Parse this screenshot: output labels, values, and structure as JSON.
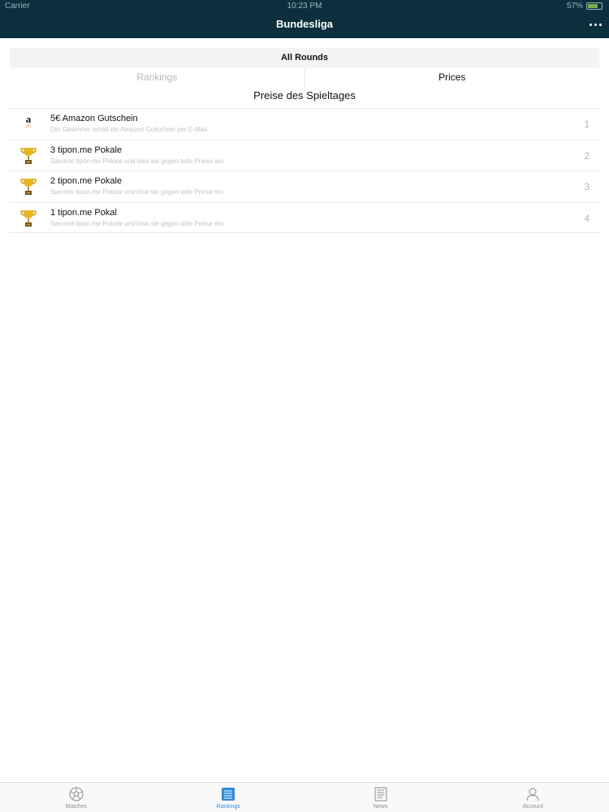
{
  "status_bar": {
    "carrier": "Carrier",
    "time": "10:23 PM",
    "battery_percent": "57%"
  },
  "nav": {
    "title": "Bundesliga"
  },
  "round_selector": {
    "label": "All Rounds"
  },
  "segments": [
    {
      "label": "Rankings",
      "selected": false
    },
    {
      "label": "Prices",
      "selected": true
    }
  ],
  "section_title": "Preise des Spieltages",
  "prizes": [
    {
      "icon": "amazon-gift-card-icon",
      "amazon_logo": "a",
      "amazon_value": "5€",
      "title": "5€ Amazon Gutschein",
      "description": "Der Gewinner erhält ein Amazon Gutschein per E-Mail.",
      "rank": "1"
    },
    {
      "icon": "trophy-icon",
      "title": "3 tipon.me Pokale",
      "description": "Sammle tipon.me Pokale und löse sie gegen tolle Preise ein.",
      "rank": "2"
    },
    {
      "icon": "trophy-icon",
      "title": "2 tipon.me Pokale",
      "description": "Sammle tipon.me Pokale und löse sie gegen tolle Preise ein.",
      "rank": "3"
    },
    {
      "icon": "trophy-icon",
      "title": "1 tipon.me Pokal",
      "description": "Sammle tipon.me Pokale und löse sie gegen tolle Preise ein.",
      "rank": "4"
    }
  ],
  "tab_bar": {
    "active_color": "#2d8be0",
    "tabs": [
      {
        "label": "Matches",
        "icon": "soccer-ball-icon"
      },
      {
        "label": "Rankings",
        "icon": "list-icon",
        "active": true
      },
      {
        "label": "News",
        "icon": "newspaper-icon"
      },
      {
        "label": "Account",
        "icon": "person-icon"
      }
    ]
  }
}
